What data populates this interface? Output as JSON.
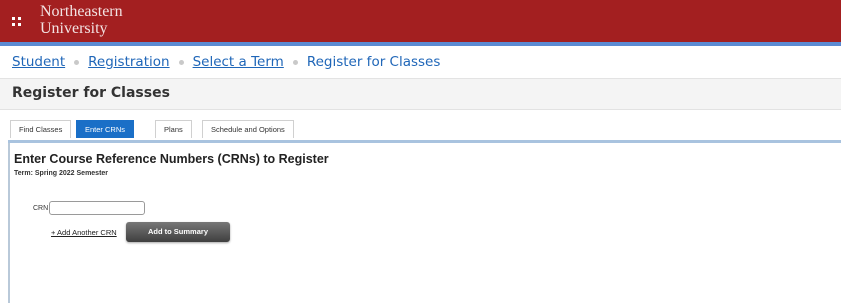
{
  "header": {
    "brand_line1": "Northeastern",
    "brand_line2": "University",
    "menu_icon": "grid-icon",
    "bar_color": "#a31f20",
    "accent_color": "#5b8bd3"
  },
  "breadcrumb": {
    "items": [
      "Student",
      "Registration",
      "Select a Term",
      "Register for Classes"
    ]
  },
  "page": {
    "title": "Register for Classes"
  },
  "tabs": [
    {
      "label": "Find Classes",
      "active": false
    },
    {
      "label": "Enter CRNs",
      "active": true
    },
    {
      "label": "Plans",
      "active": false
    },
    {
      "label": "Schedule and Options",
      "active": false
    }
  ],
  "crn_panel": {
    "heading": "Enter Course Reference Numbers (CRNs) to Register",
    "term": "Term: Spring 2022 Semester",
    "crn_label": "CRN",
    "crn_value": "",
    "add_another_label": "+ Add Another CRN",
    "add_summary_label": "Add to Summary"
  }
}
